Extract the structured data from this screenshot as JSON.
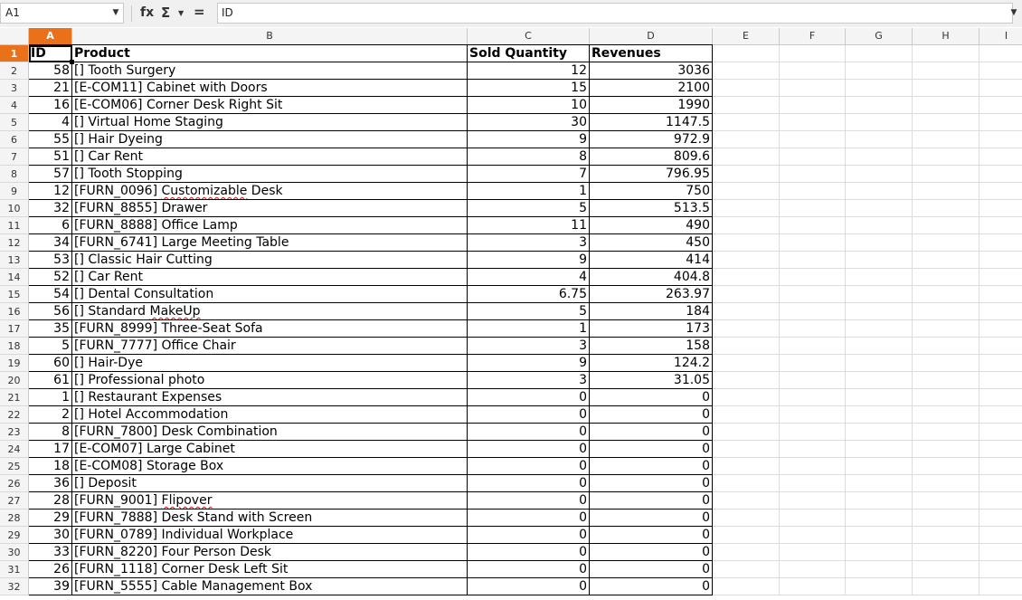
{
  "toolbar": {
    "name_box": "A1",
    "fx_label": "fx",
    "sigma_label": "Σ",
    "equals_label": "=",
    "formula": "ID"
  },
  "columns": [
    "A",
    "B",
    "C",
    "D",
    "E",
    "F",
    "G",
    "H",
    "I"
  ],
  "selected_column": "A",
  "selected_row": "1",
  "headers": {
    "id": "ID",
    "product": "Product",
    "qty": "Sold Quantity",
    "rev": "Revenues"
  },
  "rows": [
    {
      "n": "2",
      "id": "58",
      "product": "[] Tooth Surgery",
      "qty": "12",
      "rev": "3036"
    },
    {
      "n": "3",
      "id": "21",
      "product": "[E-COM11] Cabinet with Doors",
      "qty": "15",
      "rev": "2100"
    },
    {
      "n": "4",
      "id": "16",
      "product": "[E-COM06] Corner Desk Right Sit",
      "qty": "10",
      "rev": "1990"
    },
    {
      "n": "5",
      "id": "4",
      "product": "[] Virtual Home Staging",
      "qty": "30",
      "rev": "1147.5"
    },
    {
      "n": "6",
      "id": "55",
      "product": "[] Hair Dyeing",
      "qty": "9",
      "rev": "972.9"
    },
    {
      "n": "7",
      "id": "51",
      "product": "[] Car Rent",
      "qty": "8",
      "rev": "809.6"
    },
    {
      "n": "8",
      "id": "57",
      "product": "[] Tooth Stopping",
      "qty": "7",
      "rev": "796.95"
    },
    {
      "n": "9",
      "id": "12",
      "product": "[FURN_0096] Customizable Desk",
      "qty": "1",
      "rev": "750"
    },
    {
      "n": "10",
      "id": "32",
      "product": "[FURN_8855] Drawer",
      "qty": "5",
      "rev": "513.5"
    },
    {
      "n": "11",
      "id": "6",
      "product": "[FURN_8888] Office Lamp",
      "qty": "11",
      "rev": "490"
    },
    {
      "n": "12",
      "id": "34",
      "product": "[FURN_6741] Large Meeting Table",
      "qty": "3",
      "rev": "450"
    },
    {
      "n": "13",
      "id": "53",
      "product": "[] Classic Hair Cutting",
      "qty": "9",
      "rev": "414"
    },
    {
      "n": "14",
      "id": "52",
      "product": "[] Car Rent",
      "qty": "4",
      "rev": "404.8"
    },
    {
      "n": "15",
      "id": "54",
      "product": "[] Dental Consultation",
      "qty": "6.75",
      "rev": "263.97"
    },
    {
      "n": "16",
      "id": "56",
      "product": "[] Standard MakeUp",
      "qty": "5",
      "rev": "184"
    },
    {
      "n": "17",
      "id": "35",
      "product": "[FURN_8999] Three-Seat Sofa",
      "qty": "1",
      "rev": "173"
    },
    {
      "n": "18",
      "id": "5",
      "product": "[FURN_7777] Office Chair",
      "qty": "3",
      "rev": "158"
    },
    {
      "n": "19",
      "id": "60",
      "product": "[] Hair-Dye",
      "qty": "9",
      "rev": "124.2"
    },
    {
      "n": "20",
      "id": "61",
      "product": "[] Professional photo",
      "qty": "3",
      "rev": "31.05"
    },
    {
      "n": "21",
      "id": "1",
      "product": "[] Restaurant Expenses",
      "qty": "0",
      "rev": "0"
    },
    {
      "n": "22",
      "id": "2",
      "product": "[] Hotel Accommodation",
      "qty": "0",
      "rev": "0"
    },
    {
      "n": "23",
      "id": "8",
      "product": "[FURN_7800] Desk Combination",
      "qty": "0",
      "rev": "0"
    },
    {
      "n": "24",
      "id": "17",
      "product": "[E-COM07] Large Cabinet",
      "qty": "0",
      "rev": "0"
    },
    {
      "n": "25",
      "id": "18",
      "product": "[E-COM08] Storage Box",
      "qty": "0",
      "rev": "0"
    },
    {
      "n": "26",
      "id": "36",
      "product": "[] Deposit",
      "qty": "0",
      "rev": "0"
    },
    {
      "n": "27",
      "id": "28",
      "product": "[FURN_9001] Flipover",
      "qty": "0",
      "rev": "0"
    },
    {
      "n": "28",
      "id": "29",
      "product": "[FURN_7888] Desk Stand with Screen",
      "qty": "0",
      "rev": "0"
    },
    {
      "n": "29",
      "id": "30",
      "product": "[FURN_0789] Individual Workplace",
      "qty": "0",
      "rev": "0"
    },
    {
      "n": "30",
      "id": "33",
      "product": "[FURN_8220] Four Person Desk",
      "qty": "0",
      "rev": "0"
    },
    {
      "n": "31",
      "id": "26",
      "product": "[FURN_1118] Corner Desk Left Sit",
      "qty": "0",
      "rev": "0"
    },
    {
      "n": "32",
      "id": "39",
      "product": "[FURN_5555] Cable Management Box",
      "qty": "0",
      "rev": "0"
    }
  ]
}
